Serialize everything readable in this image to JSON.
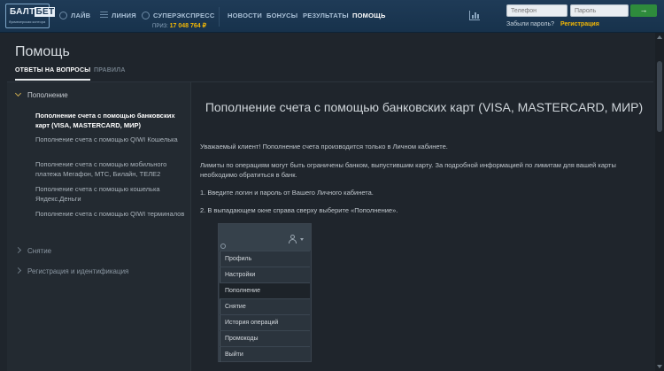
{
  "header": {
    "logo": {
      "word_part1": "БАЛТ",
      "word_part2": "БЕТ",
      "tagline": "букмекерская контора"
    },
    "nav": [
      {
        "label": "ЛАЙВ",
        "icon": "live-icon"
      },
      {
        "label": "ЛИНИЯ",
        "icon": "list-icon"
      },
      {
        "label": "СУПЕРЭКСПРЕСС",
        "icon": "superexpress-icon"
      },
      {
        "label": "НОВОСТИ"
      },
      {
        "label": "БОНУСЫ"
      },
      {
        "label": "РЕЗУЛЬТАТЫ"
      },
      {
        "label": "ПОМОЩЬ",
        "active": true
      }
    ],
    "jackpot_label": "ПРИЗ:",
    "jackpot_value": "17 048 764 ₽",
    "phone_placeholder": "Телефон",
    "password_placeholder": "Пароль",
    "forgot_label": "Забыли пароль?",
    "register_label": "Регистрация",
    "accent_color": "#f2b705",
    "go_color": "#2e8b3c"
  },
  "page": {
    "title": "Помощь",
    "tabs": [
      {
        "label": "ОТВЕТЫ НА ВОПРОСЫ",
        "active": true
      },
      {
        "label": "ПРАВИЛА",
        "active": false
      }
    ]
  },
  "sidebar": {
    "sections": [
      {
        "label": "Пополнение",
        "expanded": true,
        "items": [
          {
            "label": "Пополнение счета с помощью банковских карт (VISA, MASTERCARD, МИР)",
            "active": true
          },
          {
            "label": "Пополнение счета с помощью QIWI Кошелька"
          },
          {
            "label": "Пополнение счета с помощью мобильного платежа Мегафон, МТС, Билайн, ТЕЛЕ2"
          },
          {
            "label": "Пополнение счета с помощью кошелька Яндекс.Деньги"
          },
          {
            "label": "Пополнение счета с помощью QIWI терминалов"
          }
        ]
      },
      {
        "label": "Снятие",
        "expanded": false
      },
      {
        "label": "Регистрация и идентификация",
        "expanded": false
      }
    ]
  },
  "content": {
    "title": "Пополнение счета с помощью банковских карт (VISA, MASTERCARD, МИР)",
    "paragraphs": [
      "Уважаемый клиент! Пополнение счета производится только в Личном кабинете.",
      "Лимиты по операциям могут быть ограничены банком, выпустившим карту. За подробной информацией по лимитам для вашей карты необходимо обратиться в банк.",
      "1. Введите логин и пароль от Вашего Личного кабинета.",
      "2. В выпадающем окне справа сверху выберите «Пополнение»."
    ],
    "menu_shot": {
      "items": [
        "Профиль",
        "Настройки",
        "Пополнение",
        "Снятие",
        "История операций",
        "Промокоды",
        "Выйти"
      ],
      "active_index": 2
    }
  }
}
